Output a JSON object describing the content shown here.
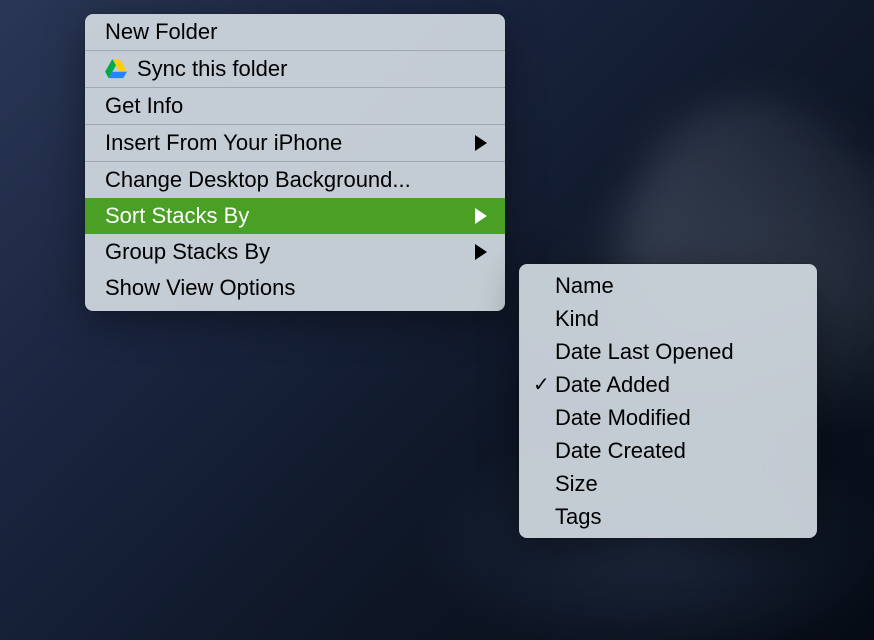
{
  "mainMenu": {
    "newFolder": "New Folder",
    "syncFolder": "Sync this folder",
    "getInfo": "Get Info",
    "insertFromPhone": "Insert From Your iPhone",
    "changeBackground": "Change Desktop Background...",
    "sortStacksBy": "Sort Stacks By",
    "groupStacksBy": "Group Stacks By",
    "showViewOptions": "Show View Options"
  },
  "subMenu": {
    "items": [
      {
        "label": "Name",
        "checked": false
      },
      {
        "label": "Kind",
        "checked": false
      },
      {
        "label": "Date Last Opened",
        "checked": false
      },
      {
        "label": "Date Added",
        "checked": true
      },
      {
        "label": "Date Modified",
        "checked": false
      },
      {
        "label": "Date Created",
        "checked": false
      },
      {
        "label": "Size",
        "checked": false
      },
      {
        "label": "Tags",
        "checked": false
      }
    ]
  },
  "colors": {
    "highlight": "#4aa025"
  }
}
